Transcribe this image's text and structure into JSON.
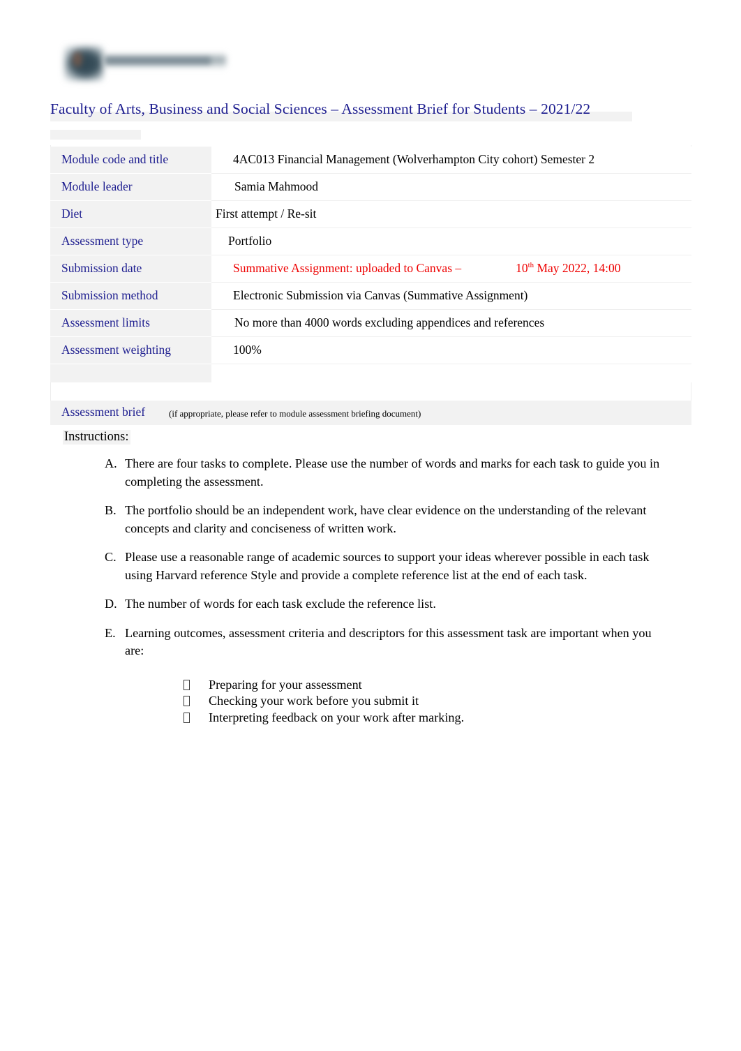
{
  "header": {
    "logo_alt": "university-logo",
    "title": "Faculty of Arts, Business and Social Sciences – Assessment Brief for Students – 2021/22"
  },
  "info_table": {
    "rows": [
      {
        "label": "Module code and title",
        "value": "4AC013 Financial Management (Wolverhampton City cohort) Semester 2"
      },
      {
        "label": "Module leader",
        "value": "Samia Mahmood"
      },
      {
        "label": "Diet",
        "value": "First attempt   /  Re-sit"
      },
      {
        "label": "Assessment type",
        "value": "Portfolio"
      },
      {
        "label": "Submission date",
        "value_red_1": "Summative Assignment: uploaded to Canvas –",
        "value_red_2_prefix": "10",
        "value_red_2_sup": "th",
        "value_red_2_suffix": " May 2022, 14:00"
      },
      {
        "label": "Submission method",
        "value": "Electronic Submission via Canvas (Summative Assignment)"
      },
      {
        "label": "Assessment limits",
        "value": "No more than 4000 words excluding appendices and references"
      },
      {
        "label": "Assessment weighting",
        "value": "100%"
      }
    ]
  },
  "brief": {
    "label": "Assessment brief",
    "note": "(if appropriate, please refer to module assessment briefing document)"
  },
  "instructions": {
    "heading": "Instructions:",
    "items": [
      {
        "marker": "A.",
        "text": "There are four tasks to complete. Please use the number of words and marks for each task to guide you in completing the assessment."
      },
      {
        "marker": "B.",
        "text": "The portfolio should be an independent work, have clear evidence on the understanding of the relevant concepts and clarity and conciseness of written work."
      },
      {
        "marker": "C.",
        "text": "Please use a reasonable range of academic sources to support your ideas wherever possible in each task using Harvard reference Style and provide a complete reference list at the end of each task."
      },
      {
        "marker": "D.",
        "text": "The number of words for each task exclude the reference list."
      },
      {
        "marker": "E.",
        "text": "Learning outcomes, assessment criteria and descriptors for this assessment task are important when you are:"
      }
    ],
    "sub_items": [
      "Preparing for your assessment",
      "Checking your work before you submit it",
      "Interpreting feedback on your work after marking."
    ]
  },
  "colors": {
    "heading_blue": "#1d1d8f",
    "alert_red": "#ee0000",
    "label_background": "#f2f2f2"
  }
}
